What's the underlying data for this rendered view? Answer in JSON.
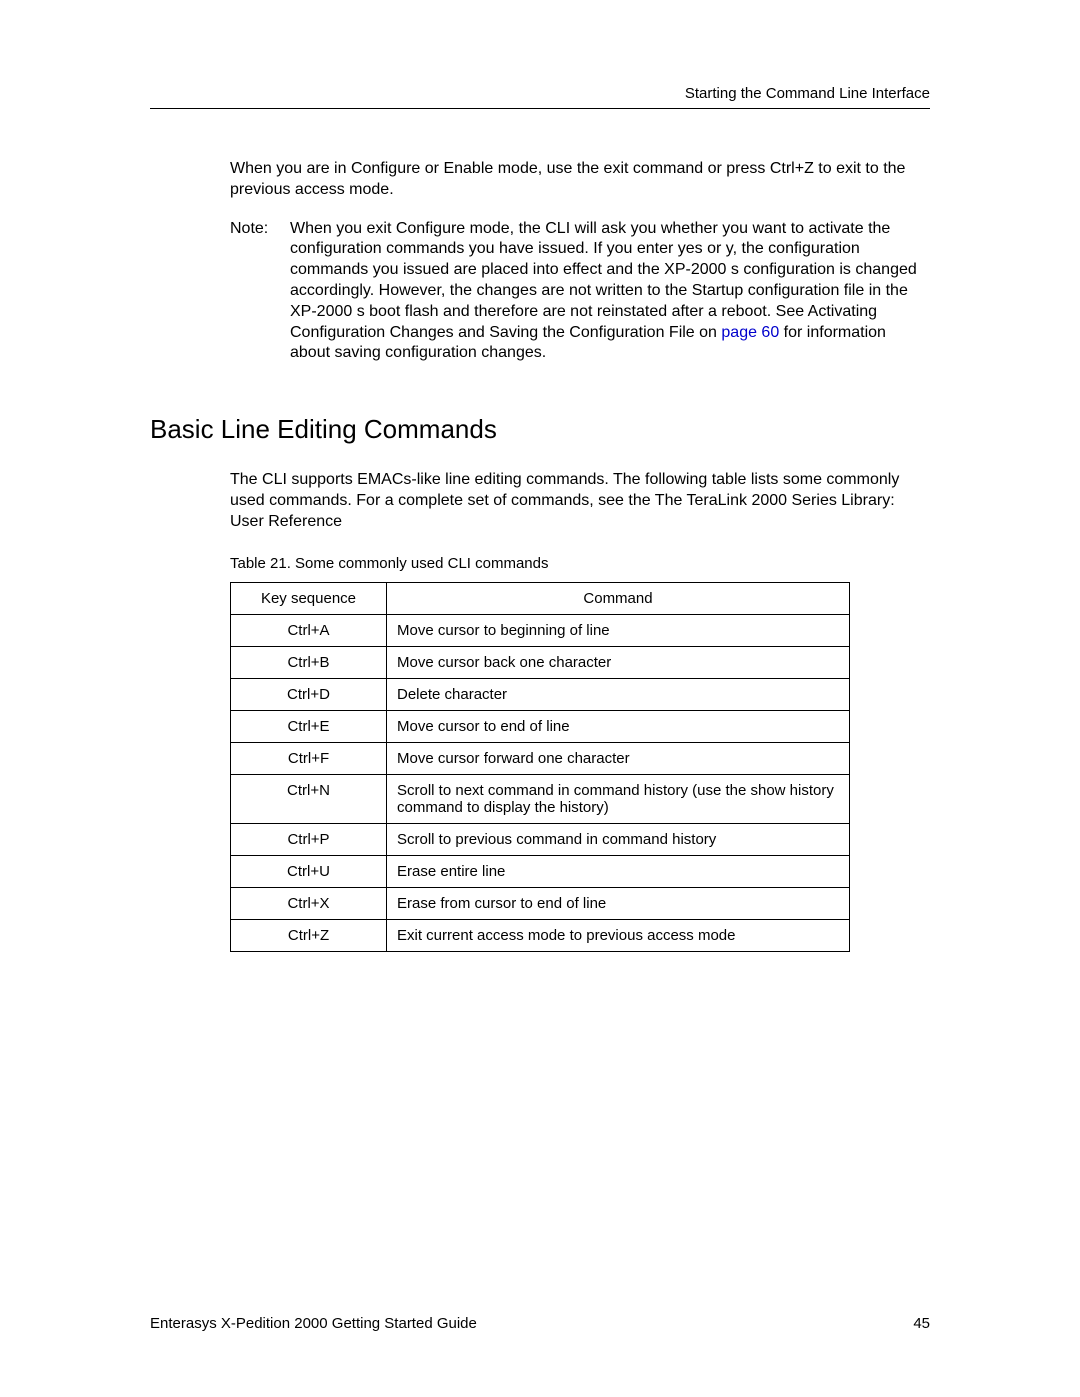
{
  "header": {
    "running_title": "Starting the Command Line Interface"
  },
  "paragraph1": "When you are in Configure or Enable mode, use the exit command or press Ctrl+Z to exit to the previous access mode.",
  "note": {
    "label": "Note:",
    "text_part1": "When you exit Configure mode, the CLI will ask you whether you want to activate the configuration commands you have issued. If you enter yes or y, the configuration commands you issued are placed into effect and the XP-2000 s configuration is changed accordingly. However, the changes are not written to the Startup configuration file in the XP-2000 s boot flash and therefore are not reinstated after a reboot. See Activating Configuration Changes and Saving the Configuration File on ",
    "link_text": "page 60",
    "text_part2": " for information about saving configuration changes."
  },
  "section": {
    "title": "Basic Line Editing Commands",
    "intro": "The CLI supports EMACs-like line editing commands. The following table lists some commonly used commands. For a complete set of commands, see the The TeraLink 2000 Series Library: User Reference"
  },
  "table": {
    "caption": "Table 21.  Some commonly used CLI commands",
    "headers": {
      "col1": "Key sequence",
      "col2": "Command"
    },
    "rows": [
      {
        "key": "Ctrl+A",
        "cmd": "Move cursor to beginning of line"
      },
      {
        "key": "Ctrl+B",
        "cmd": "Move cursor back one character"
      },
      {
        "key": "Ctrl+D",
        "cmd": "Delete character"
      },
      {
        "key": "Ctrl+E",
        "cmd": "Move cursor to end of line"
      },
      {
        "key": "Ctrl+F",
        "cmd": "Move cursor forward one character"
      },
      {
        "key": "Ctrl+N",
        "cmd": "Scroll to next command in command history (use the show history command to display the history)"
      },
      {
        "key": "Ctrl+P",
        "cmd": "Scroll to previous command in command history"
      },
      {
        "key": "Ctrl+U",
        "cmd": "Erase entire line"
      },
      {
        "key": "Ctrl+X",
        "cmd": "Erase from cursor to end of line"
      },
      {
        "key": "Ctrl+Z",
        "cmd": "Exit current access mode to previous access mode"
      }
    ]
  },
  "footer": {
    "left": "Enterasys X-Pedition 2000 Getting Started Guide",
    "right": "45"
  }
}
